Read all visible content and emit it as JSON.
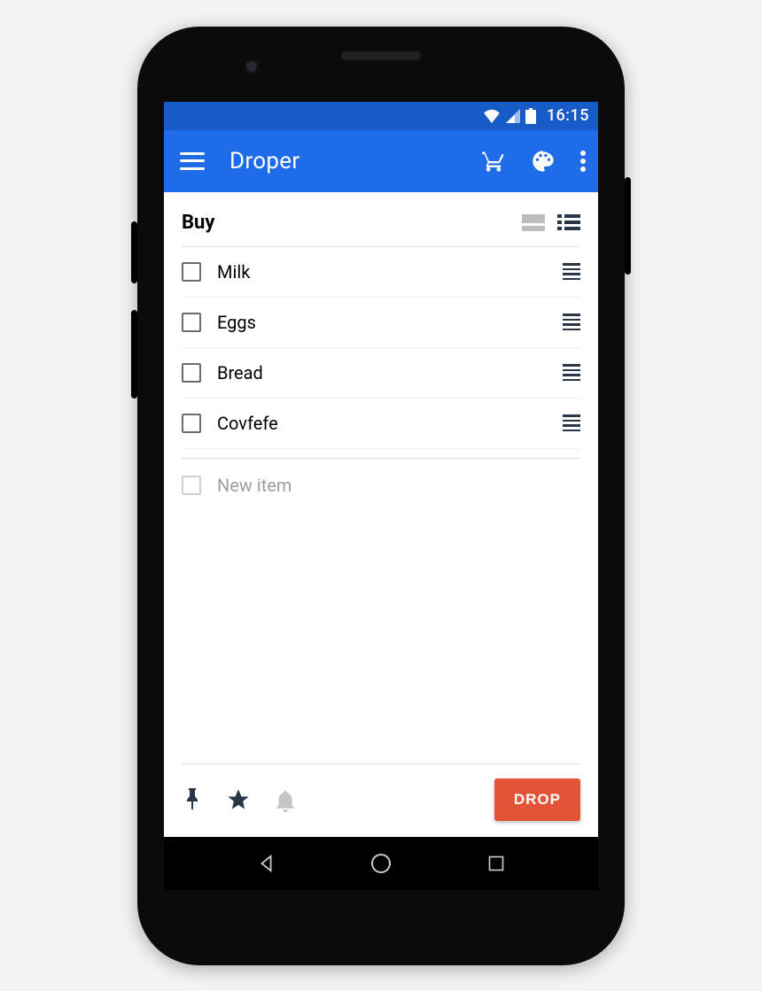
{
  "statusbar": {
    "time": "16:15"
  },
  "appbar": {
    "title": "Droper"
  },
  "list": {
    "title": "Buy",
    "items": [
      {
        "label": "Milk"
      },
      {
        "label": "Eggs"
      },
      {
        "label": "Bread"
      },
      {
        "label": "Covfefe"
      }
    ],
    "new_item_placeholder": "New item"
  },
  "actions": {
    "drop_label": "DROP"
  },
  "colors": {
    "primary": "#1e6ce7",
    "primary_dark": "#165bc7",
    "accent": "#e35436",
    "ink": "#283648"
  }
}
